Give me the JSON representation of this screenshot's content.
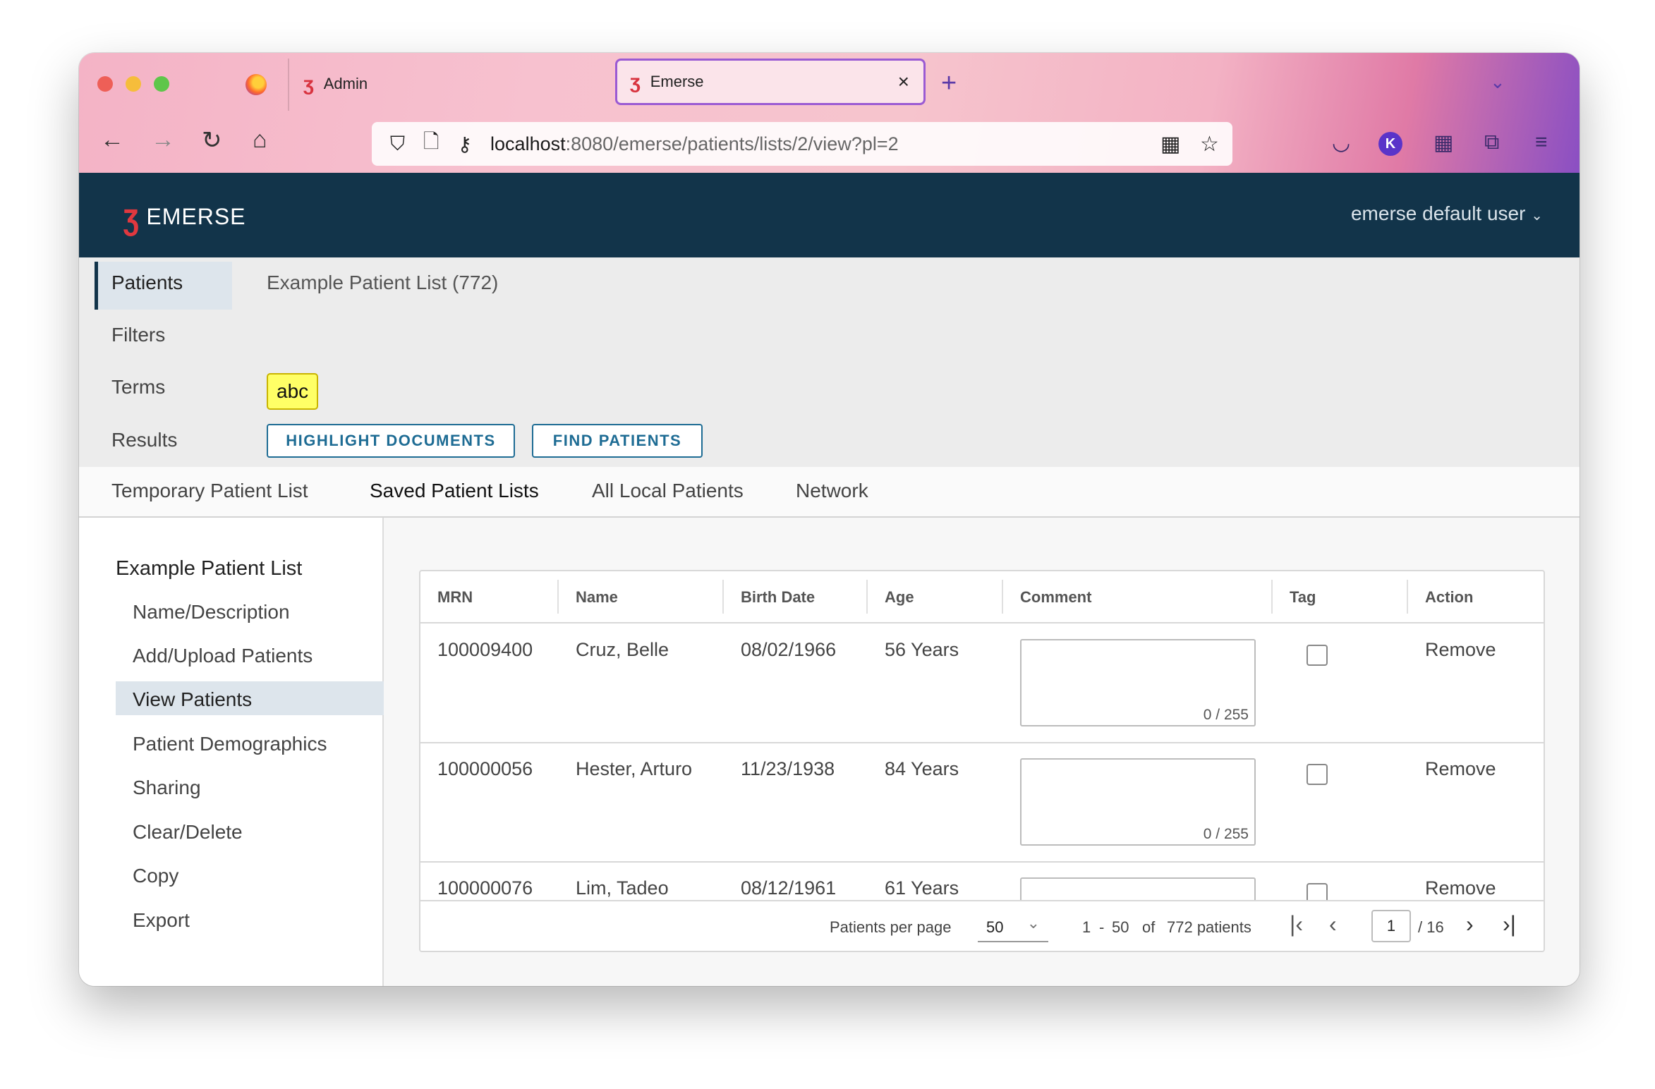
{
  "browser": {
    "tabs": [
      {
        "label": "Admin"
      },
      {
        "label": "Emerse"
      }
    ],
    "url": {
      "host": "localhost",
      "rest": ":8080/emerse/patients/lists/2/view?pl=2"
    },
    "profile_initial": "K"
  },
  "app": {
    "brand": "EMERSE",
    "user": "emerse default user",
    "user_caret": "⌄"
  },
  "filter_panel": {
    "labels": {
      "patients": "Patients",
      "filters": "Filters",
      "terms": "Terms",
      "results": "Results"
    },
    "patient_list": "Example Patient List (772)",
    "term_chip": "abc",
    "buttons": {
      "highlight": "HIGHLIGHT DOCUMENTS",
      "find": "FIND PATIENTS"
    }
  },
  "main_tabs": [
    {
      "label": "Temporary Patient List"
    },
    {
      "label": "Saved Patient Lists"
    },
    {
      "label": "All Local Patients"
    },
    {
      "label": "Network"
    }
  ],
  "sidebar": {
    "title": "Example Patient List",
    "items": [
      {
        "label": "Name/Description"
      },
      {
        "label": "Add/Upload Patients"
      },
      {
        "label": "View Patients"
      },
      {
        "label": "Patient Demographics"
      },
      {
        "label": "Sharing"
      },
      {
        "label": "Clear/Delete"
      },
      {
        "label": "Copy"
      },
      {
        "label": "Export"
      }
    ],
    "active": "View Patients"
  },
  "table": {
    "columns": [
      "MRN",
      "Name",
      "Birth Date",
      "Age",
      "Comment",
      "Tag",
      "Action"
    ],
    "rows": [
      {
        "mrn": "100009400",
        "name": "Cruz, Belle",
        "birth": "08/02/1966",
        "age": "56 Years",
        "counter": "0 / 255",
        "action": "Remove"
      },
      {
        "mrn": "100000056",
        "name": "Hester, Arturo",
        "birth": "11/23/1938",
        "age": "84 Years",
        "counter": "0 / 255",
        "action": "Remove"
      },
      {
        "mrn": "100000076",
        "name": "Lim, Tadeo",
        "birth": "08/12/1961",
        "age": "61 Years",
        "counter": "",
        "action": "Remove"
      }
    ]
  },
  "pager": {
    "per_page_label": "Patients per page",
    "per_page_value": "50",
    "range_start": "1",
    "dash": "-",
    "range_end": "50",
    "of": "of",
    "total": "772 patients",
    "current_page": "1",
    "total_pages": "/ 16"
  }
}
